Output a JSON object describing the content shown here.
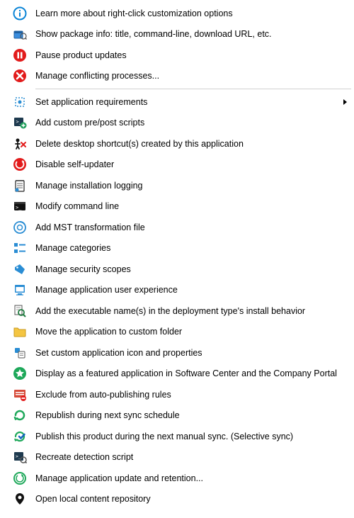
{
  "menu": {
    "items": [
      {
        "label": "Learn more about right-click customization options"
      },
      {
        "label": "Show package info: title, command-line, download URL, etc."
      },
      {
        "label": "Pause product updates"
      },
      {
        "label": "Manage conflicting processes..."
      },
      {
        "label": "Set application requirements",
        "submenu": true
      },
      {
        "label": "Add custom pre/post scripts"
      },
      {
        "label": "Delete desktop shortcut(s) created by this application"
      },
      {
        "label": "Disable self-updater"
      },
      {
        "label": "Manage installation logging"
      },
      {
        "label": "Modify command line"
      },
      {
        "label": "Add MST transformation file"
      },
      {
        "label": "Manage categories"
      },
      {
        "label": "Manage security scopes"
      },
      {
        "label": "Manage application user experience"
      },
      {
        "label": "Add the executable name(s) in the deployment type's install behavior"
      },
      {
        "label": "Move the application to custom folder"
      },
      {
        "label": "Set custom application icon and properties"
      },
      {
        "label": "Display as a featured application in Software Center and the Company Portal"
      },
      {
        "label": "Exclude from auto-publishing rules"
      },
      {
        "label": "Republish during next sync schedule"
      },
      {
        "label": "Publish this product during the next manual sync. (Selective sync)"
      },
      {
        "label": "Recreate detection script"
      },
      {
        "label": "Manage application update and retention..."
      },
      {
        "label": "Open local content repository"
      }
    ]
  }
}
